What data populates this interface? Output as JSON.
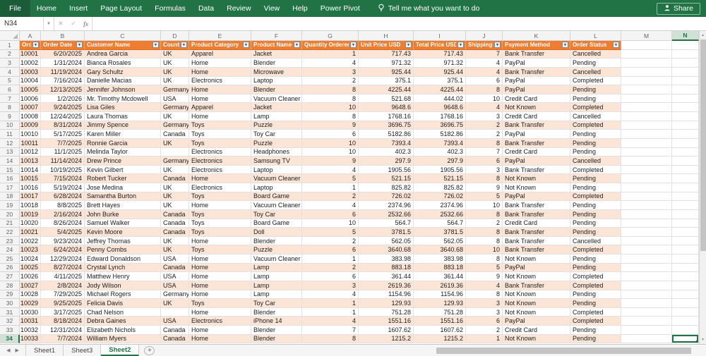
{
  "ribbon": {
    "tabs": [
      "File",
      "Home",
      "Insert",
      "Page Layout",
      "Formulas",
      "Data",
      "Review",
      "View",
      "Help",
      "Power Pivot"
    ],
    "tell_me": "Tell me what you want to do",
    "share": "Share"
  },
  "formula_bar": {
    "name_box": "N34",
    "formula_value": ""
  },
  "grid": {
    "column_letters": [
      "A",
      "B",
      "C",
      "D",
      "E",
      "F",
      "G",
      "H",
      "I",
      "J",
      "K",
      "L",
      "M",
      "N"
    ],
    "selected_cell": "N34",
    "selected_column": "N",
    "selected_row": 34
  },
  "table": {
    "headers": [
      "Order ID",
      "Order Date",
      "Customer Name",
      "Country",
      "Product Category",
      "Product Name",
      "Quantity Ordered",
      "Unit Price USD",
      "Total Price USD",
      "Shipping Days",
      "Payment Method",
      "Order Status"
    ],
    "rows": [
      [
        "10001",
        "6/20/2025",
        "Andrea Garcia",
        "UK",
        "Apparel",
        "Jacket",
        "1",
        "717.43",
        "717.43",
        "7",
        "Bank Transfer",
        "Cancelled"
      ],
      [
        "10002",
        "1/31/2024",
        "Bianca Rosales",
        "UK",
        "Home",
        "Blender",
        "4",
        "971.32",
        "971.32",
        "4",
        "PayPal",
        "Pending"
      ],
      [
        "10003",
        "11/19/2024",
        "Gary Schultz",
        "UK",
        "Home",
        "Microwave",
        "3",
        "925.44",
        "925.44",
        "4",
        "Bank Transfer",
        "Cancelled"
      ],
      [
        "10004",
        "7/16/2024",
        "Danielle Macias",
        "UK",
        "Electronics",
        "Laptop",
        "2",
        "375.1",
        "375.1",
        "6",
        "PayPal",
        "Completed"
      ],
      [
        "10005",
        "12/13/2025",
        "Jennifer Johnson",
        "Germany",
        "Home",
        "Blender",
        "8",
        "4225.44",
        "4225.44",
        "8",
        "PayPal",
        "Pending"
      ],
      [
        "10006",
        "1/2/2026",
        "Mr. Timothy Mcdowell",
        "USA",
        "Home",
        "Vacuum Cleaner",
        "8",
        "521.68",
        "444.02",
        "10",
        "Credit Card",
        "Pending"
      ],
      [
        "10007",
        "9/24/2025",
        "Lisa Giles",
        "Germany",
        "Apparel",
        "Jacket",
        "10",
        "9648.6",
        "9648.6",
        "4",
        "Not Known",
        "Completed"
      ],
      [
        "10008",
        "12/24/2025",
        "Laura Thomas",
        "UK",
        "Home",
        "Lamp",
        "8",
        "1768.16",
        "1768.16",
        "3",
        "Credit Card",
        "Cancelled"
      ],
      [
        "10009",
        "8/31/2024",
        "Jimmy Spence",
        "Germany",
        "Toys",
        "Puzzle",
        "9",
        "3696.75",
        "3696.75",
        "2",
        "Bank Transfer",
        "Completed"
      ],
      [
        "10010",
        "5/17/2025",
        "Karen Miller",
        "Canada",
        "Toys",
        "Toy Car",
        "6",
        "5182.86",
        "5182.86",
        "2",
        "PayPal",
        "Pending"
      ],
      [
        "10011",
        "7/7/2025",
        "Ronnie Garcia",
        "UK",
        "Toys",
        "Puzzle",
        "10",
        "7393.4",
        "7393.4",
        "8",
        "Bank Transfer",
        "Pending"
      ],
      [
        "10012",
        "11/1/2025",
        "Melinda Taylor",
        "",
        "Electronics",
        "Headphones",
        "10",
        "402.3",
        "402.3",
        "7",
        "Credit Card",
        "Pending"
      ],
      [
        "10013",
        "11/14/2024",
        "Drew Prince",
        "Germany",
        "Electronics",
        "Samsung TV",
        "9",
        "297.9",
        "297.9",
        "6",
        "PayPal",
        "Cancelled"
      ],
      [
        "10014",
        "10/19/2025",
        "Kevin Gilbert",
        "UK",
        "Electronics",
        "Laptop",
        "4",
        "1905.56",
        "1905.56",
        "3",
        "Bank Transfer",
        "Completed"
      ],
      [
        "10015",
        "7/15/2024",
        "Robert Tucker",
        "Canada",
        "Home",
        "Vacuum Cleaner",
        "5",
        "521.15",
        "521.15",
        "8",
        "Not Known",
        "Pending"
      ],
      [
        "10016",
        "5/19/2024",
        "Jose Medina",
        "UK",
        "Electronics",
        "Laptop",
        "1",
        "825.82",
        "825.82",
        "9",
        "Not Known",
        "Pending"
      ],
      [
        "10017",
        "6/28/2024",
        "Samantha Burton",
        "UK",
        "Toys",
        "Board Game",
        "2",
        "726.02",
        "726.02",
        "5",
        "PayPal",
        "Completed"
      ],
      [
        "10018",
        "8/8/2025",
        "Brett Hayes",
        "UK",
        "Home",
        "Vacuum Cleaner",
        "4",
        "2374.96",
        "2374.96",
        "10",
        "Bank Transfer",
        "Pending"
      ],
      [
        "10019",
        "2/16/2024",
        "John Burke",
        "Canada",
        "Toys",
        "Toy Car",
        "6",
        "2532.66",
        "2532.66",
        "8",
        "Bank Transfer",
        "Pending"
      ],
      [
        "10020",
        "8/26/2024",
        "Samuel Walker",
        "Canada",
        "Toys",
        "Board Game",
        "10",
        "564.7",
        "564.7",
        "2",
        "Credit Card",
        "Pending"
      ],
      [
        "10021",
        "5/4/2025",
        "Kevin Moore",
        "Canada",
        "Toys",
        "Doll",
        "5",
        "3781.5",
        "3781.5",
        "8",
        "Bank Transfer",
        "Pending"
      ],
      [
        "10022",
        "9/23/2024",
        "Jeffrey Thomas",
        "UK",
        "Home",
        "Blender",
        "2",
        "562.05",
        "562.05",
        "8",
        "Bank Transfer",
        "Cancelled"
      ],
      [
        "10023",
        "6/24/2024",
        "Penny Combs",
        "UK",
        "Toys",
        "Puzzle",
        "6",
        "3640.68",
        "3640.68",
        "10",
        "Bank Transfer",
        "Completed"
      ],
      [
        "10024",
        "12/29/2024",
        "Edward Donaldson",
        "USA",
        "Home",
        "Vacuum Cleaner",
        "1",
        "383.98",
        "383.98",
        "8",
        "Not Known",
        "Pending"
      ],
      [
        "10025",
        "8/27/2024",
        "Crystal Lynch",
        "Canada",
        "Home",
        "Lamp",
        "2",
        "883.18",
        "883.18",
        "5",
        "PayPal",
        "Pending"
      ],
      [
        "10026",
        "4/11/2025",
        "Matthew Henry",
        "USA",
        "Home",
        "Lamp",
        "6",
        "361.44",
        "361.44",
        "9",
        "Not Known",
        "Completed"
      ],
      [
        "10027",
        "2/8/2024",
        "Jody Wilson",
        "USA",
        "Home",
        "Lamp",
        "3",
        "2619.36",
        "2619.36",
        "4",
        "Bank Transfer",
        "Completed"
      ],
      [
        "10028",
        "7/29/2025",
        "Michael Rogers",
        "Germany",
        "Home",
        "Lamp",
        "4",
        "1154.96",
        "1154.96",
        "8",
        "Not Known",
        "Pending"
      ],
      [
        "10029",
        "9/25/2025",
        "Felicia Davis",
        "UK",
        "Toys",
        "Toy Car",
        "1",
        "129.93",
        "129.93",
        "3",
        "Not Known",
        "Pending"
      ],
      [
        "10030",
        "3/17/2025",
        "Chad Nelson",
        "",
        "Home",
        "Blender",
        "1",
        "751.28",
        "751.28",
        "3",
        "Not Known",
        "Completed"
      ],
      [
        "10031",
        "8/18/2024",
        "Debra Gaines",
        "USA",
        "Electronics",
        "iPhone 14",
        "4",
        "1551.16",
        "1551.16",
        "6",
        "PayPal",
        "Completed"
      ],
      [
        "10032",
        "12/31/2024",
        "Elizabeth Nichols",
        "Canada",
        "Home",
        "Blender",
        "7",
        "1607.62",
        "1607.62",
        "2",
        "Credit Card",
        "Pending"
      ],
      [
        "10033",
        "7/7/2024",
        "William Myers",
        "Canada",
        "Home",
        "Blender",
        "8",
        "1215.2",
        "1215.2",
        "1",
        "Not Known",
        "Pending"
      ]
    ]
  },
  "sheet_bar": {
    "tabs": [
      "Sheet1",
      "Sheet3",
      "Sheet2"
    ],
    "active_tab": "Sheet2"
  },
  "colors": {
    "ribbon_green": "#217346",
    "table_header_orange": "#ED7D31",
    "band_peach": "#FCE4D6",
    "selection_green": "#217346"
  }
}
